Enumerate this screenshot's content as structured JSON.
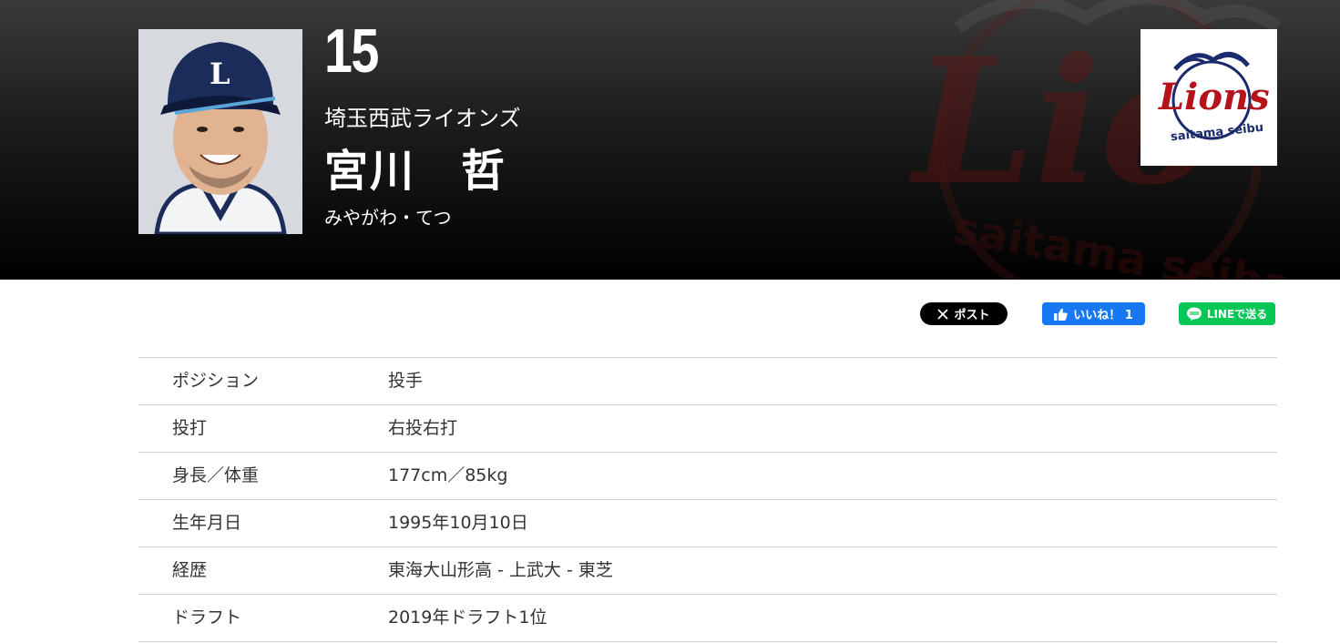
{
  "player": {
    "number": "15",
    "team": "埼玉西武ライオンズ",
    "name": "宮川　哲",
    "kana": "みやがわ・てつ"
  },
  "team_logo": {
    "text": "Lions",
    "subtext": "saitama seibu",
    "color": "#b5121b",
    "navy": "#1a2a6c"
  },
  "share": {
    "x_label": "ポスト",
    "fb_label": "いいね！ 1",
    "line_label": "LINEで送る"
  },
  "profile": [
    {
      "label": "ポジション",
      "value": "投手"
    },
    {
      "label": "投打",
      "value": "右投右打"
    },
    {
      "label": "身長／体重",
      "value": "177cm／85kg"
    },
    {
      "label": "生年月日",
      "value": "1995年10月10日"
    },
    {
      "label": "経歴",
      "value": "東海大山形高 - 上武大 - 東芝"
    },
    {
      "label": "ドラフト",
      "value": "2019年ドラフト1位"
    }
  ]
}
